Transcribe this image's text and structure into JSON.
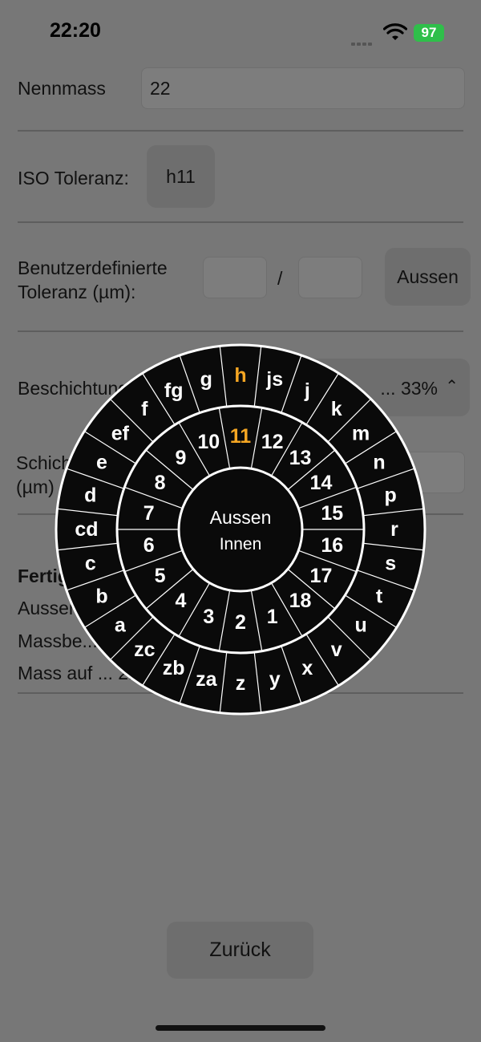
{
  "status": {
    "time": "22:20",
    "battery": "97"
  },
  "form": {
    "nennmass_label": "Nennmass",
    "nennmass_value": "22",
    "iso_label": "ISO Toleranz:",
    "iso_value": "h11",
    "custom_label_line1": "Benutzerdefinierte",
    "custom_label_line2": "Toleranz (µm):",
    "custom_sep": "/",
    "custom_mode": "Aussen",
    "coating_label": "Beschichtung:",
    "coating_value": "... 33%",
    "layer_label_line1": "Schichtdicke",
    "layer_label_line2": "(µm)"
  },
  "results": {
    "heading": "Fertigmass",
    "line1": "Aussen...",
    "line2": "Massbe... 2...",
    "line3": "Mass auf ... 21,9..."
  },
  "back_button": "Zurück",
  "wheel": {
    "center_primary": "Aussen",
    "center_secondary": "Innen",
    "outer_letters": [
      "h",
      "js",
      "j",
      "k",
      "m",
      "n",
      "p",
      "r",
      "s",
      "t",
      "u",
      "v",
      "x",
      "y",
      "z",
      "za",
      "zb",
      "zc",
      "a",
      "b",
      "c",
      "cd",
      "d",
      "e",
      "ef",
      "f",
      "fg",
      "g"
    ],
    "inner_grades": [
      "11",
      "12",
      "13",
      "14",
      "15",
      "16",
      "17",
      "18",
      "1",
      "2",
      "3",
      "4",
      "5",
      "6",
      "7",
      "8",
      "9",
      "10"
    ],
    "selected_letter": "h",
    "selected_grade": "11",
    "highlight_color": "#f5a623"
  }
}
